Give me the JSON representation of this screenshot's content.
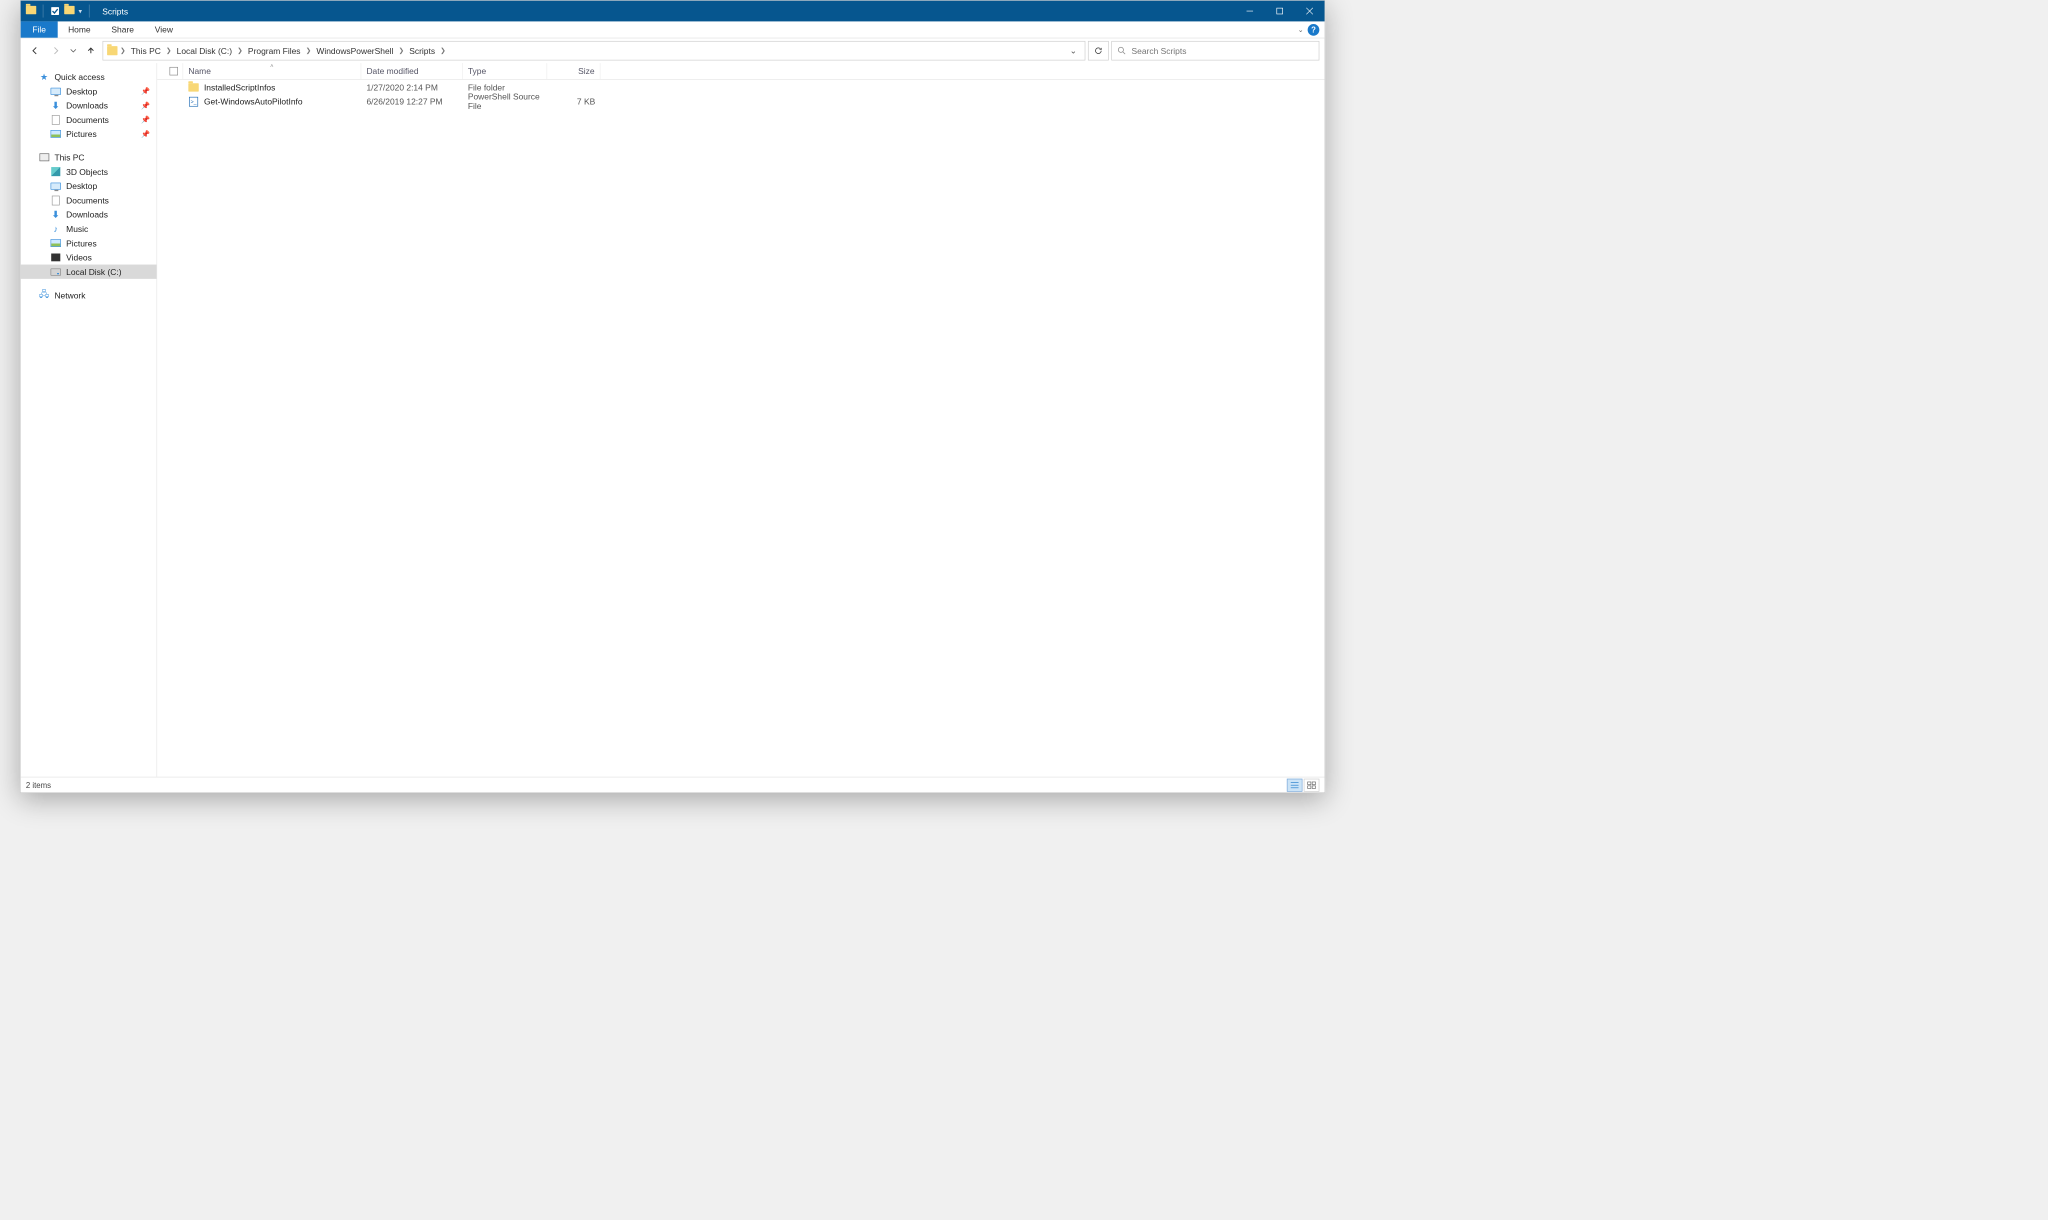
{
  "window": {
    "title": "Scripts"
  },
  "ribbon": {
    "file": "File",
    "tabs": [
      "Home",
      "Share",
      "View"
    ]
  },
  "breadcrumb": {
    "items": [
      "This PC",
      "Local Disk (C:)",
      "Program Files",
      "WindowsPowerShell",
      "Scripts"
    ]
  },
  "search": {
    "placeholder": "Search Scripts"
  },
  "sidebar": {
    "quick_access": {
      "label": "Quick access",
      "items": [
        {
          "label": "Desktop",
          "icon": "monitor",
          "pinned": true
        },
        {
          "label": "Downloads",
          "icon": "down",
          "pinned": true
        },
        {
          "label": "Documents",
          "icon": "doc",
          "pinned": true
        },
        {
          "label": "Pictures",
          "icon": "pic",
          "pinned": true
        }
      ]
    },
    "this_pc": {
      "label": "This PC",
      "items": [
        {
          "label": "3D Objects",
          "icon": "3d"
        },
        {
          "label": "Desktop",
          "icon": "monitor"
        },
        {
          "label": "Documents",
          "icon": "doc"
        },
        {
          "label": "Downloads",
          "icon": "down"
        },
        {
          "label": "Music",
          "icon": "music"
        },
        {
          "label": "Pictures",
          "icon": "pic"
        },
        {
          "label": "Videos",
          "icon": "video"
        },
        {
          "label": "Local Disk (C:)",
          "icon": "drive",
          "selected": true
        }
      ]
    },
    "network": {
      "label": "Network"
    }
  },
  "columns": {
    "name": "Name",
    "date": "Date modified",
    "type": "Type",
    "size": "Size"
  },
  "files": [
    {
      "name": "InstalledScriptInfos",
      "date": "1/27/2020 2:14 PM",
      "type": "File folder",
      "size": "",
      "icon": "folder"
    },
    {
      "name": "Get-WindowsAutoPilotInfo",
      "date": "6/26/2019 12:27 PM",
      "type": "PowerShell Source File",
      "size": "7 KB",
      "icon": "ps"
    }
  ],
  "status": {
    "count": "2 items"
  }
}
